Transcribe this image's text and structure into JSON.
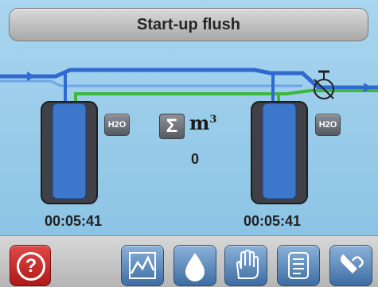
{
  "header": {
    "title": "Start-up flush"
  },
  "plant": {
    "left_badge": "H2O",
    "right_badge": "H2O",
    "unit_symbol": "m",
    "unit_power": "3",
    "sigma_symbol": "Σ",
    "volume_value": "0",
    "left_timer": "00:05:41",
    "right_timer": "00:05:41"
  },
  "toolbar": {
    "help_symbol": "?",
    "icons": [
      "chart-icon",
      "water-drop-icon",
      "hand-icon",
      "document-icon",
      "wrench-icon"
    ]
  },
  "colors": {
    "background": "#8fc6e6",
    "pipe_blue": "#2f6ad0",
    "pipe_green": "#3cb83c",
    "tank_dark": "#3f4146",
    "tank_blue": "#3c77cc",
    "help_red": "#c62828"
  }
}
